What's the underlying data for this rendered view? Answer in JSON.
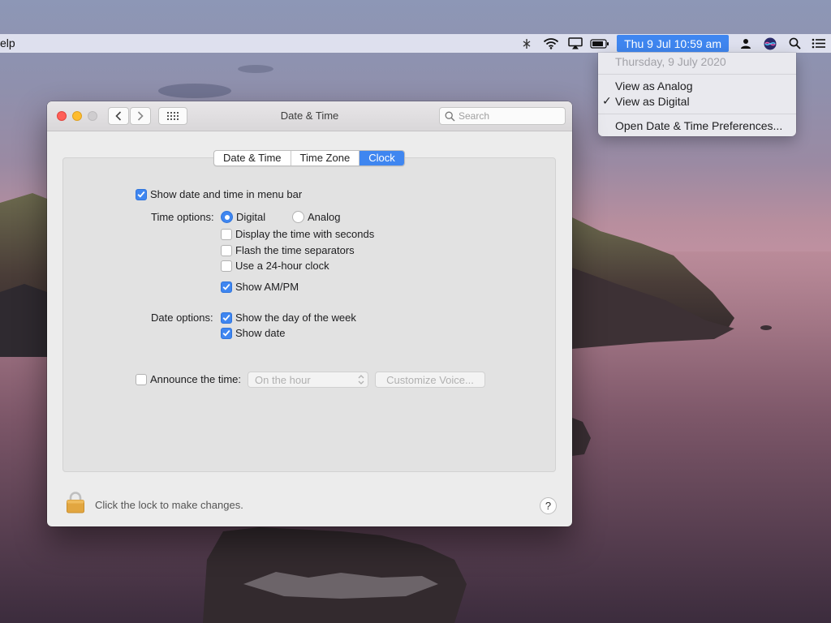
{
  "menubar": {
    "app_menu_partial": "elp",
    "clock": "Thu 9 Jul  10:59 am",
    "icons": [
      "screen-mirror-icon",
      "wifi-icon",
      "airplay-icon",
      "battery-icon",
      "user-icon",
      "siri-icon",
      "spotlight-search-icon",
      "notification-center-icon"
    ]
  },
  "clock_menu": {
    "date_line": "Thursday, 9 July 2020",
    "view_analog": "View as Analog",
    "view_digital": "View as Digital",
    "checkmark": "✓",
    "open_prefs": "Open Date & Time Preferences..."
  },
  "window": {
    "title": "Date & Time",
    "search_placeholder": "Search",
    "nav_back": "‹",
    "nav_forward": "›",
    "tabs": [
      {
        "label": "Date & Time",
        "active": false
      },
      {
        "label": "Time Zone",
        "active": false
      },
      {
        "label": "Clock",
        "active": true
      }
    ]
  },
  "clock_tab": {
    "show_in_menubar": {
      "label": "Show date and time in menu bar",
      "checked": true
    },
    "time_options_label": "Time options:",
    "digital_label": "Digital",
    "analog_label": "Analog",
    "selected_style": "Digital",
    "display_seconds": {
      "label": "Display the time with seconds",
      "checked": false
    },
    "flash_separators": {
      "label": "Flash the time separators",
      "checked": false
    },
    "use_24h": {
      "label": "Use a 24-hour clock",
      "checked": false
    },
    "show_ampm": {
      "label": "Show AM/PM",
      "checked": true
    },
    "date_options_label": "Date options:",
    "show_day_of_week": {
      "label": "Show the day of the week",
      "checked": true
    },
    "show_date": {
      "label": "Show date",
      "checked": true
    },
    "announce": {
      "label": "Announce the time:",
      "checked": false,
      "interval": "On the hour",
      "customize_label": "Customize Voice..."
    }
  },
  "footer": {
    "lock_text": "Click the lock to make changes.",
    "help_label": "?"
  },
  "colors": {
    "accent": "#3f86f0",
    "lock": "#e2a640"
  }
}
